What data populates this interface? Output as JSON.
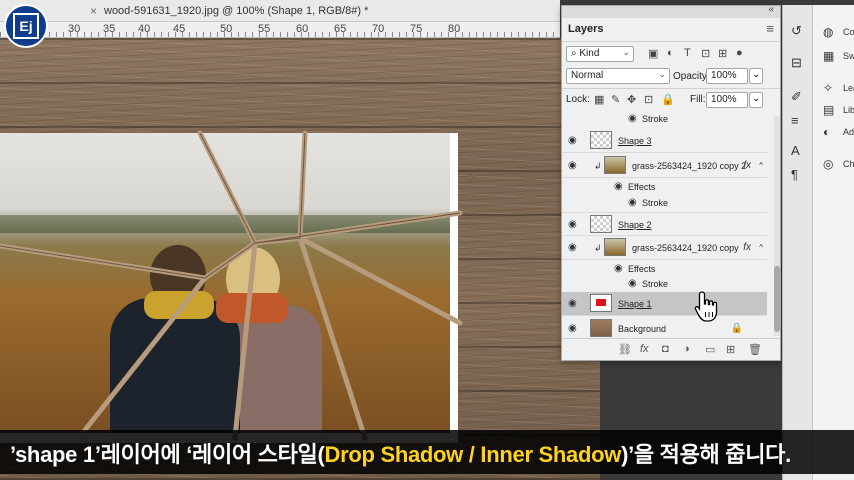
{
  "document": {
    "title": "wood-591631_1920.jpg @ 100% (Shape 1, RGB/8#) *",
    "close_glyph": "×"
  },
  "logo": {
    "text": "Ej"
  },
  "ruler": {
    "marks": [
      "30",
      "35",
      "40",
      "45",
      "50",
      "55",
      "60",
      "65",
      "70",
      "75",
      "80"
    ]
  },
  "layers_panel": {
    "title": "Layers",
    "filter": {
      "kind_label": "Kind"
    },
    "blend_mode": "Normal",
    "opacity_label": "Opacity:",
    "opacity_value": "100%",
    "lock_label": "Lock:",
    "fill_label": "Fill:",
    "fill_value": "100%",
    "layers": [
      {
        "id": "stroke-top",
        "name": "Stroke",
        "kind": "effect"
      },
      {
        "id": "shape3",
        "name": "Shape 3",
        "kind": "shape"
      },
      {
        "id": "grass2",
        "name": "grass-2563424_1920 copy 2",
        "kind": "image",
        "fx": "fx"
      },
      {
        "id": "effects2",
        "name": "Effects",
        "kind": "effects-header"
      },
      {
        "id": "stroke2",
        "name": "Stroke",
        "kind": "effect"
      },
      {
        "id": "shape2",
        "name": "Shape 2",
        "kind": "shape"
      },
      {
        "id": "grass1",
        "name": "grass-2563424_1920 copy",
        "kind": "image",
        "fx": "fx"
      },
      {
        "id": "effects1",
        "name": "Effects",
        "kind": "effects-header"
      },
      {
        "id": "stroke1",
        "name": "Stroke",
        "kind": "effect"
      },
      {
        "id": "shape1",
        "name": "Shape 1",
        "kind": "shape",
        "selected": true
      },
      {
        "id": "background",
        "name": "Background",
        "kind": "background"
      }
    ]
  },
  "dock": {
    "items": [
      {
        "label": "Co",
        "icon": "color-icon"
      },
      {
        "label": "Sw",
        "icon": "swatches-icon"
      },
      {
        "label": "Lea",
        "icon": "learn-icon"
      },
      {
        "label": "Lib",
        "icon": "libraries-icon"
      },
      {
        "label": "Ad",
        "icon": "adjustments-icon"
      },
      {
        "label": "Ch",
        "icon": "channels-icon"
      }
    ]
  },
  "subtitle": {
    "part1": "’shape 1’레이어에 ‘레이어 스타일(",
    "highlight": "Drop Shadow / Inner Shadow",
    "part2": ")’을 적용해 줍니다."
  },
  "colors": {
    "subtitle_highlight": "#ffd21e",
    "logo_bg": "#0f3c8c",
    "shape_red": "#e0151b"
  }
}
